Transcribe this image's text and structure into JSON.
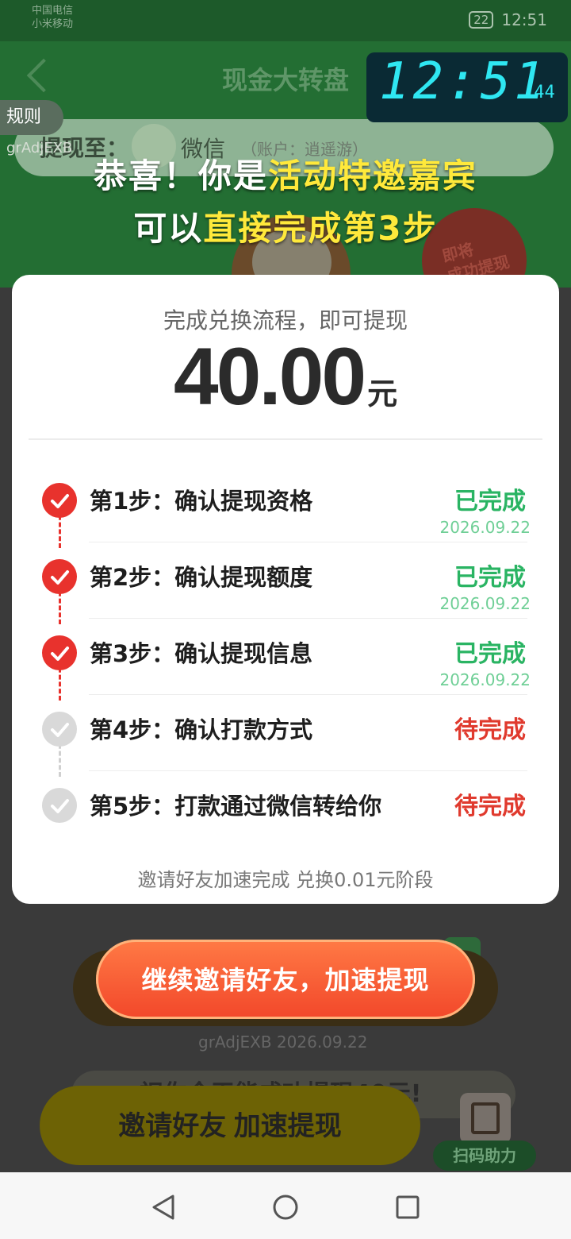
{
  "status_bar": {
    "carrier_1": "中国电信",
    "carrier_2": "小米移动",
    "battery": "22",
    "time": "12:51"
  },
  "background_page": {
    "title": "现金大转盘",
    "rules_label": "规则",
    "user_id": "grAdjEXB",
    "withdraw_to_label": "提现至：",
    "wechat_label": "微信",
    "account_text": "（账户：逍遥游）",
    "stamp_text_1": "即将",
    "stamp_text_2": "成功提现",
    "user_id_date": "grAdjEXB 2026.09.22",
    "promo_text": "祝你今天能成功提现40元!",
    "invite_button": "邀请好友 加速提现",
    "scan_button": "扫码助力"
  },
  "clock": {
    "digits": "12:51",
    "seconds": ":44"
  },
  "headline": {
    "line1_prefix": "恭喜！你是",
    "line1_highlight": "活动特邀嘉宾",
    "line2_prefix": "可以",
    "line2_highlight": "直接完成第3步"
  },
  "modal": {
    "subtitle": "完成兑换流程，即可提现",
    "amount": "40.00",
    "unit": "元",
    "steps": [
      {
        "label": "第1步：确认提现资格",
        "status": "已完成",
        "date": "2026.09.22"
      },
      {
        "label": "第2步：确认提现额度",
        "status": "已完成",
        "date": "2026.09.22"
      },
      {
        "label": "第3步：确认提现信息",
        "status": "已完成",
        "date": "2026.09.22"
      },
      {
        "label": "第4步：确认打款方式",
        "status": "待完成",
        "date": ""
      },
      {
        "label": "第5步：打款通过微信转给你",
        "status": "待完成",
        "date": ""
      }
    ],
    "footer": "邀请好友加速完成 兑换0.01元阶段"
  },
  "cta": {
    "label": "继续邀请好友，加速提现"
  },
  "colors": {
    "done": "#2ab463",
    "pending": "#e03a2e",
    "step_done_icon": "#e8322d",
    "cta": "#f2472a",
    "highlight": "#ffe93b"
  },
  "icons": [
    "check-circle-icon",
    "back-icon",
    "home-icon",
    "recent-apps-icon",
    "wechat-icon",
    "qr-code-icon"
  ]
}
